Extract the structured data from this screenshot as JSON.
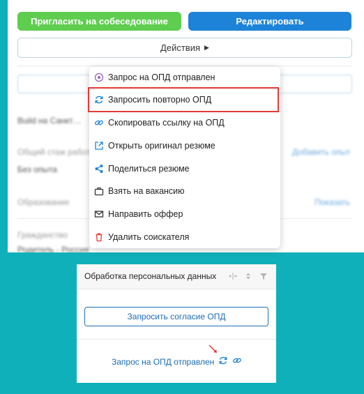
{
  "top": {
    "invite_label": "Пригласить на собеседование",
    "edit_label": "Редактировать",
    "actions_label": "Действия"
  },
  "background": {
    "blur1": "Build на Санкт…",
    "blur2": "Общий стаж работы",
    "blur3": "Без опыта",
    "blur4": "Добавить опыт",
    "blur5": "Образование",
    "blur6": "Показать",
    "blur7": "Гражданство",
    "blur8": "Родитель - Россия"
  },
  "menu": {
    "items": [
      {
        "label": "Запрос на ОПД отправлен",
        "icon": "clock-circle-icon"
      },
      {
        "label": "Запросить повторно ОПД",
        "icon": "refresh-icon"
      },
      {
        "label": "Скопировать ссылку на ОПД",
        "icon": "link-icon"
      },
      {
        "label": "Открыть оригинал резюме",
        "icon": "external-link-icon"
      },
      {
        "label": "Поделиться резюме",
        "icon": "share-icon"
      },
      {
        "label": "Взять на вакансию",
        "icon": "briefcase-icon"
      },
      {
        "label": "Направить оффер",
        "icon": "mail-icon"
      },
      {
        "label": "Удалить соискателя",
        "icon": "trash-icon"
      }
    ]
  },
  "bottom": {
    "header_title": "Обработка персональных данных",
    "consent_button": "Запросить согласие ОПД",
    "status_text": "Запрос на ОПД отправлен"
  },
  "colors": {
    "accent_green": "#5fcd4f",
    "accent_blue": "#1c83d8",
    "highlight": "#e53935",
    "background": "#0fb0b9"
  }
}
